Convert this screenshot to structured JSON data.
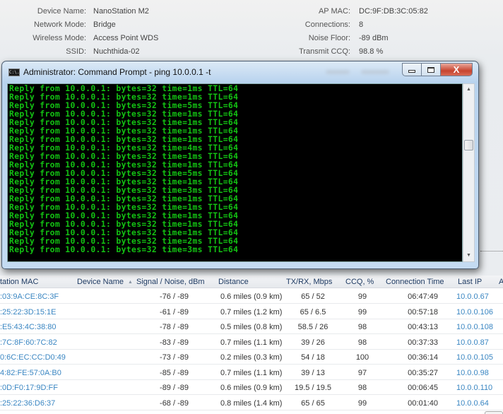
{
  "status": {
    "left": [
      {
        "label": "Device Name:",
        "value": "NanoStation M2"
      },
      {
        "label": "Network Mode:",
        "value": "Bridge"
      },
      {
        "label": "Wireless Mode:",
        "value": "Access Point WDS"
      },
      {
        "label": "SSID:",
        "value": "Nuchthida-02"
      }
    ],
    "right": [
      {
        "label": "AP MAC:",
        "value": "DC:9F:DB:3C:05:82"
      },
      {
        "label": "Connections:",
        "value": "8"
      },
      {
        "label": "Noise Floor:",
        "value": "-89 dBm"
      },
      {
        "label": "Transmit CCQ:",
        "value": "98.8 %"
      }
    ]
  },
  "cmd_window": {
    "title": "Administrator: Command Prompt - ping  10.0.0.1 -t",
    "icon": "cmd-icon",
    "icon_text": "C:\\.",
    "buttons": {
      "minimize": "minimize",
      "maximize": "maximize",
      "close": "X"
    },
    "scroll_up": "▲",
    "scroll_down": "▼",
    "lines": [
      "Reply from 10.0.0.1: bytes=32 time=1ms TTL=64",
      "Reply from 10.0.0.1: bytes=32 time=1ms TTL=64",
      "Reply from 10.0.0.1: bytes=32 time=5ms TTL=64",
      "Reply from 10.0.0.1: bytes=32 time=1ms TTL=64",
      "Reply from 10.0.0.1: bytes=32 time=1ms TTL=64",
      "Reply from 10.0.0.1: bytes=32 time=1ms TTL=64",
      "Reply from 10.0.0.1: bytes=32 time=1ms TTL=64",
      "Reply from 10.0.0.1: bytes=32 time=4ms TTL=64",
      "Reply from 10.0.0.1: bytes=32 time=1ms TTL=64",
      "Reply from 10.0.0.1: bytes=32 time=1ms TTL=64",
      "Reply from 10.0.0.1: bytes=32 time=5ms TTL=64",
      "Reply from 10.0.0.1: bytes=32 time=1ms TTL=64",
      "Reply from 10.0.0.1: bytes=32 time=3ms TTL=64",
      "Reply from 10.0.0.1: bytes=32 time=1ms TTL=64",
      "Reply from 10.0.0.1: bytes=32 time=1ms TTL=64",
      "Reply from 10.0.0.1: bytes=32 time=1ms TTL=64",
      "Reply from 10.0.0.1: bytes=32 time=1ms TTL=64",
      "Reply from 10.0.0.1: bytes=32 time=1ms TTL=64",
      "Reply from 10.0.0.1: bytes=32 time=2ms TTL=64",
      "Reply from 10.0.0.1: bytes=32 time=3ms TTL=64"
    ]
  },
  "stations": {
    "headers": [
      "tation MAC",
      "Device Name",
      "Signal / Noise, dBm",
      "Distance",
      "TX/RX, Mbps",
      "CCQ, %",
      "Connection Time",
      "Last IP",
      "A"
    ],
    "sort_indicator": "▲",
    "rows": [
      {
        "mac": ":03:9A:CE:8C:3F",
        "name": "",
        "signal": "-76 / -89",
        "distance": "0.6 miles (0.9 km)",
        "txrx": "65 / 52",
        "ccq": "99",
        "time": "06:47:49",
        "ip": "10.0.0.67"
      },
      {
        "mac": ":25:22:3D:15:1E",
        "name": "",
        "signal": "-61 / -89",
        "distance": "0.7 miles (1.2 km)",
        "txrx": "65 / 6.5",
        "ccq": "99",
        "time": "00:57:18",
        "ip": "10.0.0.106"
      },
      {
        "mac": ":E5:43:4C:38:80",
        "name": "",
        "signal": "-78 / -89",
        "distance": "0.5 miles (0.8 km)",
        "txrx": "58.5 / 26",
        "ccq": "98",
        "time": "00:43:13",
        "ip": "10.0.0.108"
      },
      {
        "mac": ":7C:8F:60:7C:82",
        "name": "",
        "signal": "-83 / -89",
        "distance": "0.7 miles (1.1 km)",
        "txrx": "39 / 26",
        "ccq": "98",
        "time": "00:37:33",
        "ip": "10.0.0.87"
      },
      {
        "mac": "0:6C:EC:CC:D0:49",
        "name": "",
        "signal": "-73 / -89",
        "distance": "0.2 miles (0.3 km)",
        "txrx": "54 / 18",
        "ccq": "100",
        "time": "00:36:14",
        "ip": "10.0.0.105"
      },
      {
        "mac": "4:82:FE:57:0A:B0",
        "name": "",
        "signal": "-85 / -89",
        "distance": "0.7 miles (1.1 km)",
        "txrx": "39 / 13",
        "ccq": "97",
        "time": "00:35:27",
        "ip": "10.0.0.98"
      },
      {
        "mac": ":0D:F0:17:9D:FF",
        "name": "",
        "signal": "-89 / -89",
        "distance": "0.6 miles (0.9 km)",
        "txrx": "19.5 / 19.5",
        "ccq": "98",
        "time": "00:06:45",
        "ip": "10.0.0.110"
      },
      {
        "mac": ":25:22:36:D6:37",
        "name": "",
        "signal": "-68 / -89",
        "distance": "0.8 miles (1.4 km)",
        "txrx": "65 / 65",
        "ccq": "99",
        "time": "00:01:40",
        "ip": "10.0.0.64"
      }
    ]
  }
}
